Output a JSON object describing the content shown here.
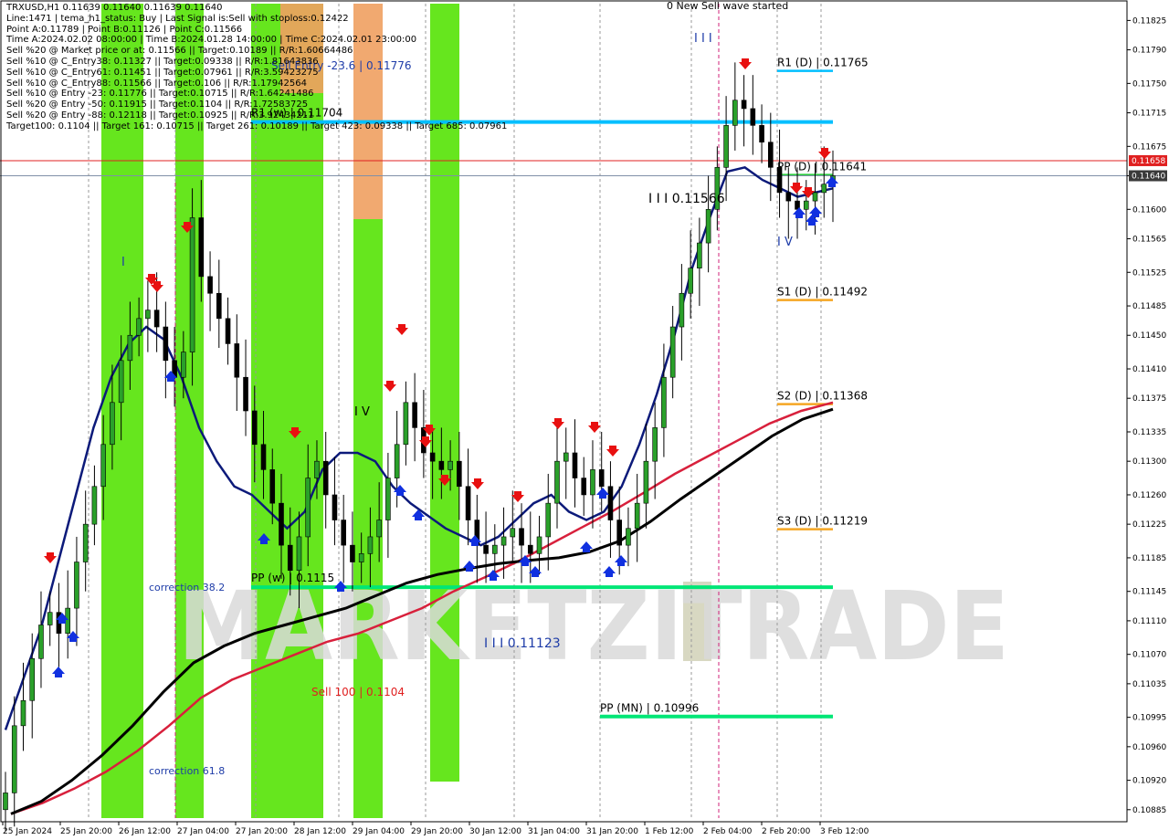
{
  "window_title": "TRXUSD,H1  0.11639 0.11640 0.11639 0.11640",
  "info_lines": [
    "Line:1471  |  tema_h1_status: Buy  |  Last Signal is:Sell with stoploss:0.12422",
    "Point A:0.11789  |  Point B:0.11126  |  Point C:0.11566",
    "Time A:2024.02.02 08:00:00  |  Time B:2024.01.28 14:00:00  |  Time C:2024.02.01 23:00:00",
    "Sell %20 @ Market price or at: 0.11566  ||  Target:0.10189  ||  R/R:1.60664486",
    "Sell %10 @ C_Entry38: 0.11327  ||  Target:0.09338  ||  R/R:1.81643836",
    "Sell %10 @ C_Entry61: 0.11451  ||  Target:0.07961  ||  R/R:3.59423275",
    "Sell %10 @ C_Entry88: 0.11566  ||  Target:0.106  ||  R/R:1.17942564",
    "Sell %10 @ Entry -23: 0.11776  ||  Target:0.10715  ||  R/R:1.64241486",
    "Sell %20 @ Entry -50: 0.11915  ||  Target:0.1104  ||  R/R:1.72583725",
    "Sell %20 @ Entry -88: 0.12118  ||  Target:0.10925  ||  R/R:3.92434211",
    "Target100: 0.1104  ||  Target 161: 0.10715  ||  Target 261: 0.10189  ||  Target 423: 0.09338  ||  Target 685: 0.07961"
  ],
  "chart_data": {
    "type": "candlestick",
    "symbol": "TRXUSD",
    "timeframe": "H1",
    "ylim": [
      0.10875,
      0.11845
    ],
    "y_ticks": [
      0.11825,
      0.1179,
      0.1175,
      0.11715,
      0.11675,
      0.1164,
      0.116,
      0.11565,
      0.11525,
      0.11485,
      0.1145,
      0.1141,
      0.11375,
      0.11335,
      0.113,
      0.1126,
      0.11225,
      0.11185,
      0.11145,
      0.1111,
      0.1107,
      0.11035,
      0.10995,
      0.1096,
      0.1092,
      0.10885
    ],
    "x_ticks": [
      "25 Jan 2024",
      "25 Jan 20:00",
      "26 Jan 12:00",
      "27 Jan 04:00",
      "27 Jan 20:00",
      "28 Jan 12:00",
      "29 Jan 04:00",
      "29 Jan 20:00",
      "30 Jan 12:00",
      "31 Jan 04:00",
      "31 Jan 20:00",
      "1 Feb 12:00",
      "2 Feb 04:00",
      "2 Feb 20:00",
      "3 Feb 12:00"
    ],
    "current_price": 0.1164,
    "current_price_label": "0.11640",
    "red_line_price": 0.11658,
    "red_line_label": "0.11658",
    "close_series": [
      0.10905,
      0.10985,
      0.11015,
      0.11065,
      0.11105,
      0.1112,
      0.11095,
      0.11125,
      0.1118,
      0.11225,
      0.1127,
      0.1132,
      0.1137,
      0.1142,
      0.1145,
      0.1147,
      0.1148,
      0.1146,
      0.1142,
      0.114,
      0.1143,
      0.1159,
      0.1152,
      0.115,
      0.1147,
      0.1144,
      0.114,
      0.1136,
      0.1132,
      0.1129,
      0.1125,
      0.112,
      0.1117,
      0.1121,
      0.1128,
      0.113,
      0.1126,
      0.1123,
      0.112,
      0.1118,
      0.1119,
      0.1121,
      0.1123,
      0.1128,
      0.1132,
      0.1137,
      0.1134,
      0.1131,
      0.113,
      0.1129,
      0.113,
      0.1127,
      0.1123,
      0.112,
      0.1119,
      0.112,
      0.1121,
      0.1122,
      0.112,
      0.1119,
      0.1121,
      0.1125,
      0.113,
      0.1131,
      0.1128,
      0.1126,
      0.1129,
      0.1127,
      0.1123,
      0.112,
      0.1122,
      0.1125,
      0.113,
      0.1134,
      0.114,
      0.1146,
      0.115,
      0.1153,
      0.1156,
      0.116,
      0.1165,
      0.117,
      0.1173,
      0.1172,
      0.117,
      0.1168,
      0.1165,
      0.1162,
      0.1161,
      0.116,
      0.1161,
      0.1162,
      0.1163,
      0.1164
    ],
    "black_ma": [
      0.1088,
      0.10895,
      0.1092,
      0.1095,
      0.10985,
      0.11025,
      0.1106,
      0.1108,
      0.11095,
      0.11105,
      0.11115,
      0.11125,
      0.1114,
      0.11155,
      0.11165,
      0.11172,
      0.11178,
      0.11182,
      0.11185,
      0.11192,
      0.11205,
      0.11228,
      0.11255,
      0.1128,
      0.11305,
      0.1133,
      0.1135,
      0.11362
    ],
    "red_ma": [
      0.1088,
      0.10893,
      0.1091,
      0.1093,
      0.10955,
      0.10985,
      0.11018,
      0.1104,
      0.11055,
      0.1107,
      0.11085,
      0.11095,
      0.1111,
      0.11125,
      0.11145,
      0.11162,
      0.1118,
      0.112,
      0.1122,
      0.1124,
      0.11262,
      0.11285,
      0.11305,
      0.11325,
      0.11345,
      0.1136,
      0.1137
    ],
    "navy_ma": [
      0.1098,
      0.1104,
      0.111,
      0.1118,
      0.1126,
      0.1134,
      0.114,
      0.1144,
      0.1146,
      0.11445,
      0.114,
      0.1134,
      0.113,
      0.1127,
      0.1126,
      0.1124,
      0.1122,
      0.1124,
      0.1129,
      0.1131,
      0.1131,
      0.113,
      0.1127,
      0.1125,
      0.11235,
      0.1122,
      0.1121,
      0.112,
      0.1121,
      0.1123,
      0.1125,
      0.1126,
      0.1124,
      0.1123,
      0.1124,
      0.1127,
      0.1132,
      0.1138,
      0.1145,
      0.1153,
      0.1159,
      0.11645,
      0.1165,
      0.11635,
      0.11625,
      0.11615,
      0.1162,
      0.11625
    ],
    "levels": [
      {
        "label": "R1 (D) | 0.11765",
        "price": 0.11765,
        "color": "#00bfff"
      },
      {
        "label": "PP (D) | 0.11641",
        "price": 0.11641,
        "color": "#2ecc40"
      },
      {
        "label": "S1 (D) | 0.11492",
        "price": 0.11492,
        "color": "#f5a623"
      },
      {
        "label": "S2 (D) | 0.11368",
        "price": 0.11368,
        "color": "#f5a623"
      },
      {
        "label": "S3 (D) | 0.11219",
        "price": 0.11219,
        "color": "#f5a623"
      },
      {
        "label": "PP (MN) | 0.10996",
        "price": 0.10996,
        "color": "#00e676"
      }
    ],
    "weekly_lines": [
      {
        "label": "R1 (w) | 0.11704",
        "price": 0.11704,
        "color": "#00bfff"
      },
      {
        "label": "PP (w) | 0.1115",
        "price": 0.1115,
        "color": "#00e676"
      }
    ],
    "annotations": [
      {
        "text": "0 New Sell wave started"
      },
      {
        "text": "Sell Entry -23.6 | 0.11776"
      },
      {
        "text": "I I I 0.11566"
      },
      {
        "text": "I I I 0.11123"
      },
      {
        "text": "correction 38.2"
      },
      {
        "text": "correction 61.8"
      },
      {
        "text": "Sell 100 | 0.1104"
      },
      {
        "text": "I V"
      },
      {
        "text": "I V"
      },
      {
        "text": "I I I"
      },
      {
        "text": "I"
      }
    ],
    "watermark": "MARKETZITRADE"
  }
}
